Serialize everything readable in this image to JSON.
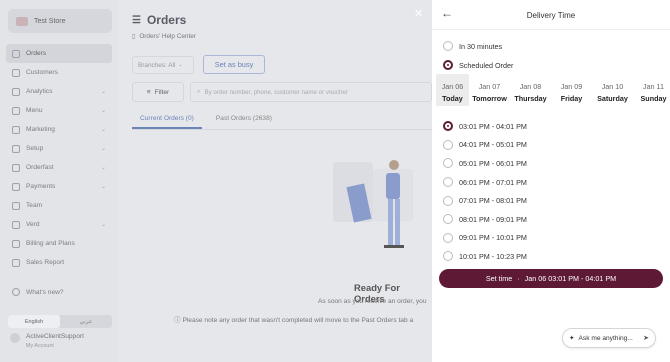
{
  "store": {
    "name": "Test Store"
  },
  "sidebar": {
    "items": [
      {
        "label": "Orders",
        "chevron": false,
        "active": true
      },
      {
        "label": "Customers",
        "chevron": false,
        "active": false
      },
      {
        "label": "Analytics",
        "chevron": true,
        "active": false
      },
      {
        "label": "Menu",
        "chevron": true,
        "active": false
      },
      {
        "label": "Marketing",
        "chevron": true,
        "active": false
      },
      {
        "label": "Setup",
        "chevron": true,
        "active": false
      },
      {
        "label": "Orderfast",
        "chevron": true,
        "active": false
      },
      {
        "label": "Payments",
        "chevron": true,
        "active": false
      },
      {
        "label": "Team",
        "chevron": false,
        "active": false
      },
      {
        "label": "Verd",
        "chevron": true,
        "active": false
      },
      {
        "label": "Billing and Plans",
        "chevron": false,
        "active": false
      },
      {
        "label": "Sales Report",
        "chevron": false,
        "active": false
      }
    ],
    "whats_new": "What's new?",
    "lang_en": "English",
    "lang_ar": "عربي",
    "user_name": "ActiveClientSupport",
    "user_sub": "My Account"
  },
  "main": {
    "title": "Orders",
    "help": "Orders' Help Center",
    "branches_label": "Branches: All",
    "busy_button": "Set as busy",
    "filter_label": "Filter",
    "search_placeholder": "By order number, phone, customer name or voucher",
    "tabs": [
      "Current Orders (0)",
      "Past Orders (2638)"
    ],
    "ready_title": "Ready For Orders",
    "ready_sub": "As soon as you receive an order, you",
    "note": "Please note any order that wasn't completed will move to the Past Orders tab a"
  },
  "panel": {
    "title": "Delivery Time",
    "options": [
      {
        "label": "In 30 minutes",
        "selected": false
      },
      {
        "label": "Scheduled Order",
        "selected": true
      }
    ],
    "days": [
      {
        "date": "Jan 06",
        "name": "Today"
      },
      {
        "date": "Jan 07",
        "name": "Tomorrow"
      },
      {
        "date": "Jan 08",
        "name": "Thursday"
      },
      {
        "date": "Jan 09",
        "name": "Friday"
      },
      {
        "date": "Jan 10",
        "name": "Saturday"
      },
      {
        "date": "Jan 11",
        "name": "Sunday"
      }
    ],
    "slots": [
      {
        "label": "03:01 PM - 04:01 PM",
        "selected": true
      },
      {
        "label": "04:01 PM - 05:01 PM",
        "selected": false
      },
      {
        "label": "05:01 PM - 06:01 PM",
        "selected": false
      },
      {
        "label": "06:01 PM - 07:01 PM",
        "selected": false
      },
      {
        "label": "07:01 PM - 08:01 PM",
        "selected": false
      },
      {
        "label": "08:01 PM - 09:01 PM",
        "selected": false
      },
      {
        "label": "09:01 PM - 10:01 PM",
        "selected": false
      },
      {
        "label": "10:01 PM - 10:23 PM",
        "selected": false
      }
    ],
    "set_time_label": "Set time",
    "set_time_sep": "·",
    "set_time_value": "Jan 06 03:01 PM - 04:01 PM",
    "ask_placeholder": "Ask me anything..."
  },
  "colors": {
    "accent": "#5e1a35",
    "overlay_bg": "#e6e7eb",
    "link_blue": "#6b84b8"
  }
}
